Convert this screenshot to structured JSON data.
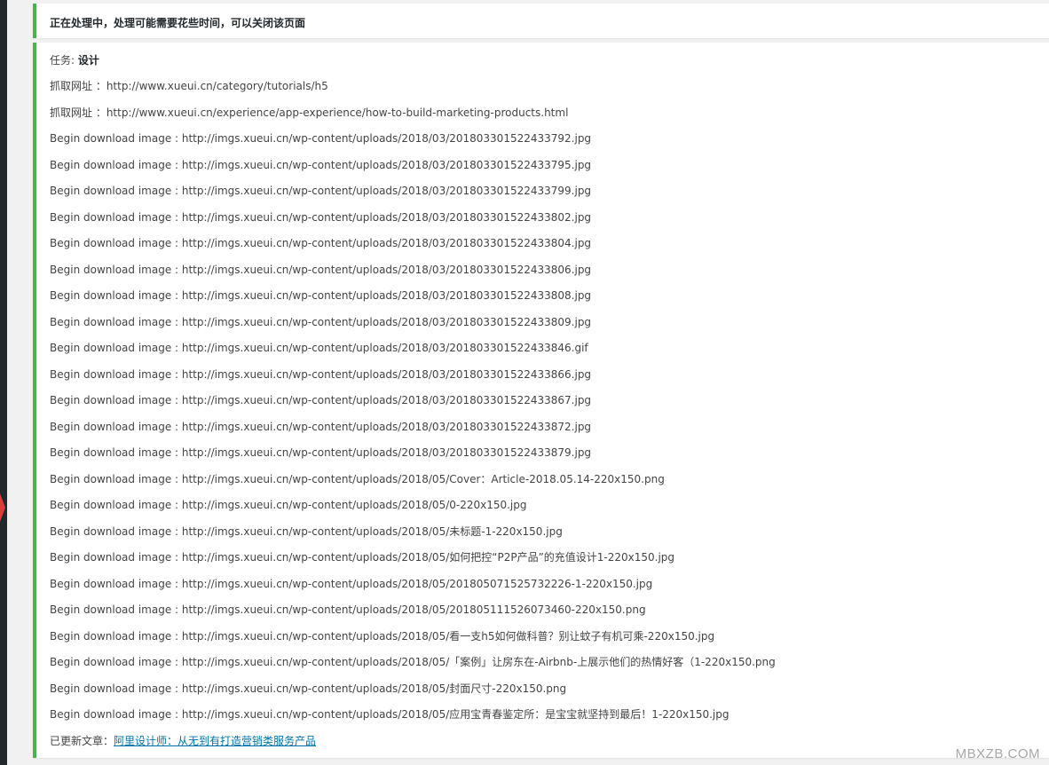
{
  "notice_top": {
    "text": "正在处理中，处理可能需要花些时间，可以关闭该页面"
  },
  "log": {
    "task_label": "任务: ",
    "task_name": "设计",
    "crawl_urls": [
      "抓取网址 ：http://www.xueui.cn/category/tutorials/h5",
      "抓取网址 ：http://www.xueui.cn/experience/app-experience/how-to-build-marketing-products.html"
    ],
    "download_lines": [
      "Begin download image : http://imgs.xueui.cn/wp-content/uploads/2018/03/201803301522433792.jpg",
      "Begin download image : http://imgs.xueui.cn/wp-content/uploads/2018/03/201803301522433795.jpg",
      "Begin download image : http://imgs.xueui.cn/wp-content/uploads/2018/03/201803301522433799.jpg",
      "Begin download image : http://imgs.xueui.cn/wp-content/uploads/2018/03/201803301522433802.jpg",
      "Begin download image : http://imgs.xueui.cn/wp-content/uploads/2018/03/201803301522433804.jpg",
      "Begin download image : http://imgs.xueui.cn/wp-content/uploads/2018/03/201803301522433806.jpg",
      "Begin download image : http://imgs.xueui.cn/wp-content/uploads/2018/03/201803301522433808.jpg",
      "Begin download image : http://imgs.xueui.cn/wp-content/uploads/2018/03/201803301522433809.jpg",
      "Begin download image : http://imgs.xueui.cn/wp-content/uploads/2018/03/201803301522433846.gif",
      "Begin download image : http://imgs.xueui.cn/wp-content/uploads/2018/03/201803301522433866.jpg",
      "Begin download image : http://imgs.xueui.cn/wp-content/uploads/2018/03/201803301522433867.jpg",
      "Begin download image : http://imgs.xueui.cn/wp-content/uploads/2018/03/201803301522433872.jpg",
      "Begin download image : http://imgs.xueui.cn/wp-content/uploads/2018/03/201803301522433879.jpg",
      "Begin download image : http://imgs.xueui.cn/wp-content/uploads/2018/05/Cover：Article-2018.05.14-220x150.png",
      "Begin download image : http://imgs.xueui.cn/wp-content/uploads/2018/05/0-220x150.jpg",
      "Begin download image : http://imgs.xueui.cn/wp-content/uploads/2018/05/未标题-1-220x150.jpg",
      "Begin download image : http://imgs.xueui.cn/wp-content/uploads/2018/05/如何把控“P2P产品”的充值设计1-220x150.jpg",
      "Begin download image : http://imgs.xueui.cn/wp-content/uploads/2018/05/201805071525732226-1-220x150.jpg",
      "Begin download image : http://imgs.xueui.cn/wp-content/uploads/2018/05/201805111526073460-220x150.png",
      "Begin download image : http://imgs.xueui.cn/wp-content/uploads/2018/05/看一支h5如何做科普？别让蚊子有机可乘-220x150.jpg",
      "Begin download image : http://imgs.xueui.cn/wp-content/uploads/2018/05/「案例」让房东在-Airbnb-上展示他们的热情好客（1-220x150.png",
      "Begin download image : http://imgs.xueui.cn/wp-content/uploads/2018/05/封面尺寸-220x150.png",
      "Begin download image : http://imgs.xueui.cn/wp-content/uploads/2018/05/应用宝青春鉴定所：是宝宝就坚持到最后！1-220x150.jpg"
    ],
    "updated_label": "已更新文章：",
    "updated_article": "阿里设计师：从无到有打造营销类服务产品"
  },
  "watermark": "MBXZB.COM",
  "colors": {
    "accent_border": "#46b450",
    "link": "#0073aa",
    "marker": "#dd3d36"
  }
}
